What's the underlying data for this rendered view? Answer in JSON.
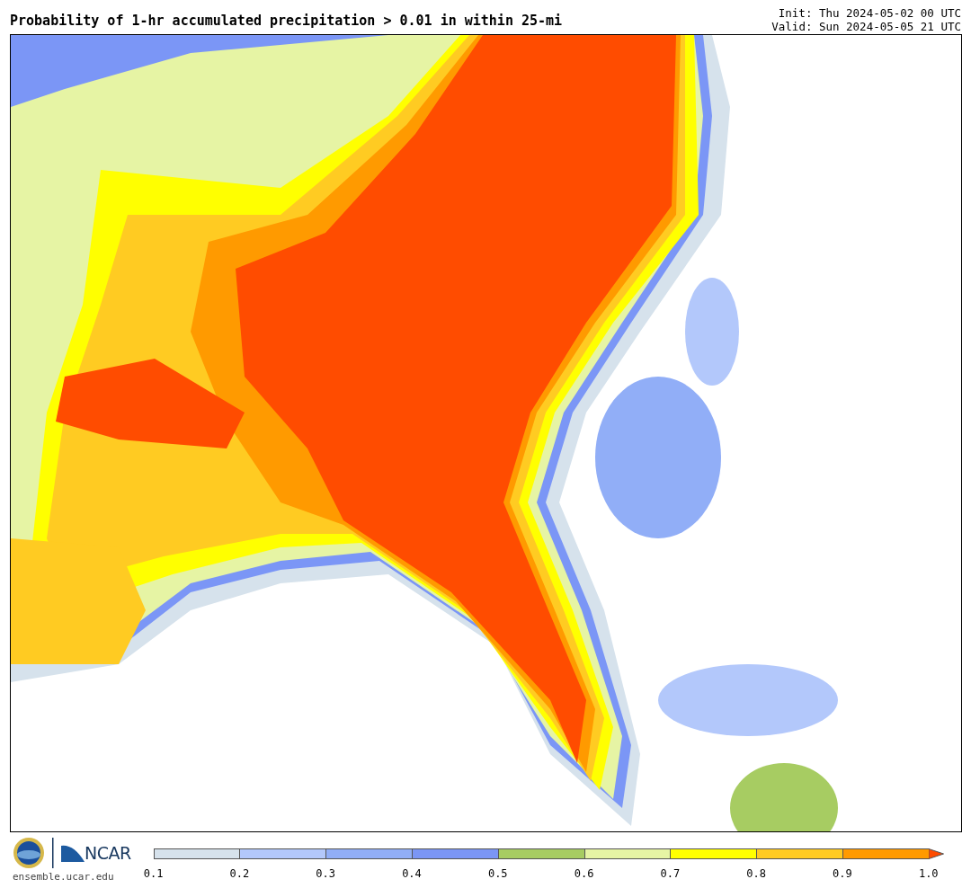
{
  "title": "Probability of 1-hr accumulated precipitation > 0.01 in within 25-mi",
  "run_info": [
    "Init: Thu 2024-05-02 00 UTC",
    "Valid: Sun 2024-05-05 21 UTC"
  ],
  "logos": {
    "ncar_text": "NCAR",
    "site": "ensemble.ucar.edu"
  },
  "colorbar": {
    "segments": [
      {
        "color": "#d6e2ec"
      },
      {
        "color": "#b3c8fb"
      },
      {
        "color": "#91aef7"
      },
      {
        "color": "#7b96f6"
      },
      {
        "color": "#a7cc62"
      },
      {
        "color": "#e6f4a4"
      },
      {
        "color": "#ffff00"
      },
      {
        "color": "#ffcb22"
      },
      {
        "color": "#ff9a00"
      }
    ],
    "extend": {
      "color": "#ff4c00"
    },
    "ticks": [
      "0.1",
      "0.2",
      "0.3",
      "0.4",
      "0.5",
      "0.6",
      "0.7",
      "0.8",
      "0.9",
      "1.0"
    ]
  }
}
